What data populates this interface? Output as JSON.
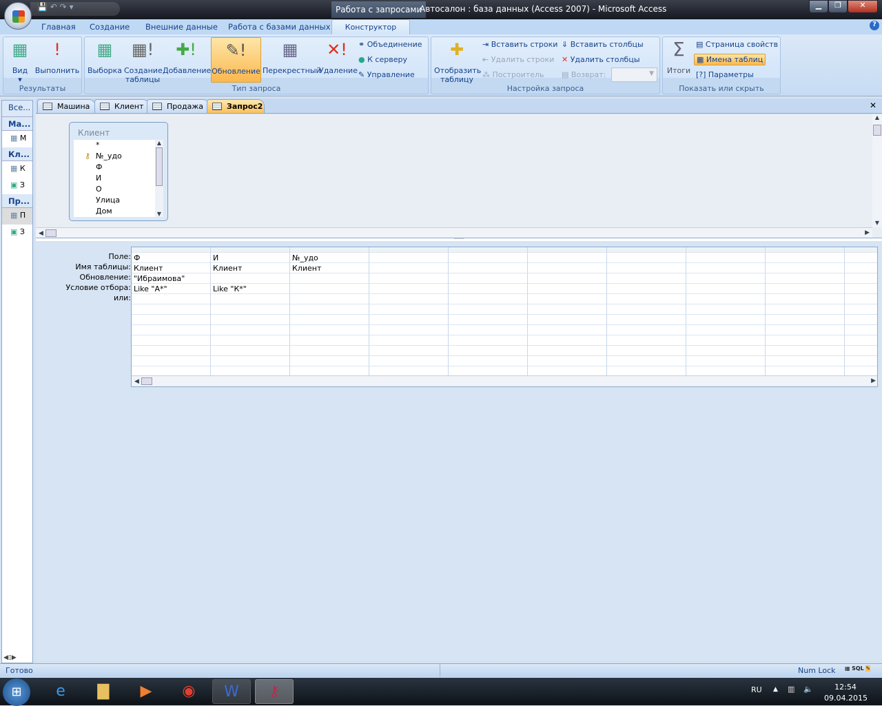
{
  "title": {
    "context_group": "Работа с запросами",
    "app": "Автосалон : база данных (Access 2007)  -  Microsoft Access"
  },
  "ribbon_tabs": [
    "Главная",
    "Создание",
    "Внешние данные",
    "Работа с базами данных",
    "Конструктор"
  ],
  "groups": {
    "results": {
      "label": "Результаты",
      "view": "Вид",
      "run": "Выполнить"
    },
    "query_type": {
      "label": "Тип запроса",
      "select": "Выборка",
      "make_table": [
        "Создание",
        "таблицы"
      ],
      "append": "Добавление",
      "update": "Обновление",
      "crosstab": "Перекрестный",
      "delete": "Удаление",
      "union": "Объединение",
      "pass_through": "К серверу",
      "data_def": "Управление"
    },
    "setup": {
      "label": "Настройка запроса",
      "show_table": [
        "Отобразить",
        "таблицу"
      ],
      "insert_rows": "Вставить строки",
      "delete_rows": "Удалить строки",
      "builder": "Построитель",
      "insert_cols": "Вставить столбцы",
      "delete_cols": "Удалить столбцы",
      "return": "Возврат:",
      "return_value": ""
    },
    "show_hide": {
      "label": "Показать или скрыть",
      "totals": "Итоги",
      "property_sheet": "Страница свойств",
      "table_names": "Имена таблиц",
      "parameters": "Параметры"
    }
  },
  "nav": {
    "header": "Все...",
    "groups": [
      {
        "label": "Ма...",
        "items": [
          "М"
        ]
      },
      {
        "label": "Кл...",
        "items": [
          "К",
          "З"
        ]
      },
      {
        "label": "Пр...",
        "items": [
          "П",
          "З"
        ]
      }
    ]
  },
  "doc_tabs": [
    "Машина",
    "Клиент",
    "Продажа",
    "Запрос2"
  ],
  "table_box": {
    "title": "Клиент",
    "fields": [
      "*",
      "№_удо",
      "Ф",
      "И",
      "О",
      "Улица",
      "Дом"
    ]
  },
  "grid": {
    "row_labels": [
      "Поле:",
      "Имя таблицы:",
      "Обновление:",
      "Условие отбора:",
      "или:"
    ],
    "columns": [
      {
        "field": "Ф",
        "table": "Клиент",
        "update": "\"Ибраимова\"",
        "criteria": "Like \"А*\"",
        "or": ""
      },
      {
        "field": "И",
        "table": "Клиент",
        "update": "",
        "criteria": "Like \"К*\"",
        "or": ""
      },
      {
        "field": "№_удо",
        "table": "Клиент",
        "update": "",
        "criteria": "",
        "or": ""
      }
    ]
  },
  "status": {
    "left": "Готово",
    "num_lock": "Num Lock",
    "sql": "SQL"
  },
  "tray": {
    "lang": "RU",
    "time": "12:54",
    "date": "09.04.2015"
  }
}
